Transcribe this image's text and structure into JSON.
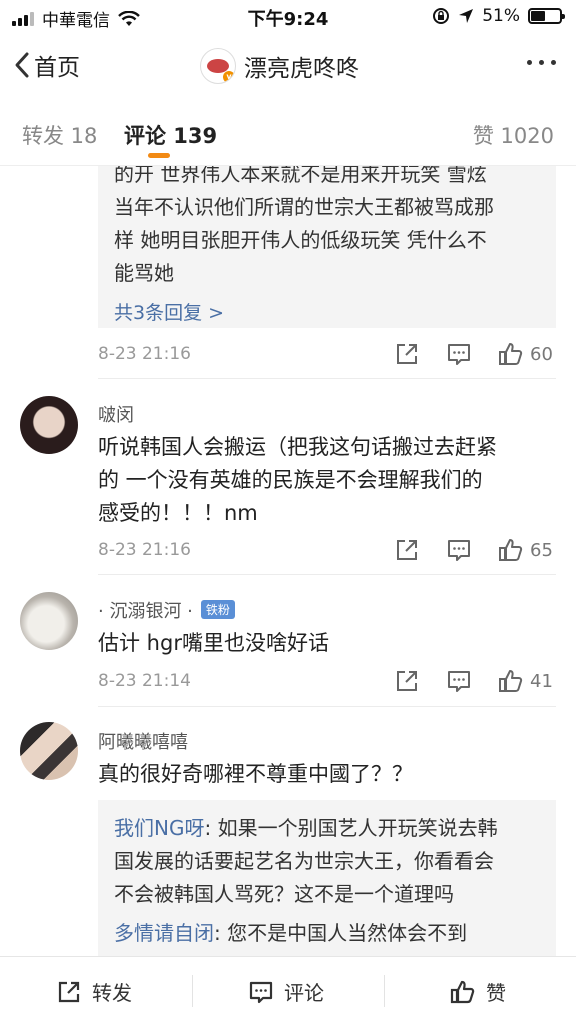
{
  "status_bar": {
    "carrier": "中華電信",
    "time": "下午9:24",
    "battery_percent": "51%",
    "battery_level": 0.51,
    "icons": [
      "signal-icon",
      "wifi-icon",
      "lock-rotation-icon",
      "location-icon",
      "battery-icon"
    ]
  },
  "nav": {
    "back_label": "首页",
    "title": "漂亮虎咚咚",
    "verified_badge": "v"
  },
  "tabs": {
    "repost": "转发 18",
    "comments": "评论 139",
    "likes": "赞 1020"
  },
  "partial_comment": {
    "reply_lines": [
      "的开 世界伟人本来就不是用来开玩笑 雪炫",
      "当年不认识他们所谓的世宗大王都被骂成那",
      "样 她明目张胆开伟人的低级玩笑 凭什么不",
      "能骂她"
    ],
    "more_replies": "共3条回复 >",
    "time": "8-23 21:16",
    "likes": "60"
  },
  "comments": [
    {
      "name": "啵闵",
      "text_lines": [
        "听说韩国人会搬运（把我这句话搬过去赶紧",
        "的  一个没有英雄的民族是不会理解我们的",
        "感受的！！！nm"
      ],
      "time": "8-23 21:16",
      "likes": "65"
    },
    {
      "name": "· 沉溺银河 ·",
      "badge": "铁粉",
      "text_lines": [
        "估计 hgr嘴里也没啥好话"
      ],
      "time": "8-23 21:14",
      "likes": "41"
    },
    {
      "name": "阿曦曦嘻嘻",
      "text_lines": [
        "真的很好奇哪裡不尊重中國了？？"
      ],
      "replies": [
        {
          "author": "我们NG呀",
          "lines": [
            "如果一个别国艺人开玩笑说去韩",
            "国发展的话要起艺名为世宗大王，你看看会",
            "不会被韩国人骂死？这不是一个道理吗"
          ]
        },
        {
          "author": "多情请自闭",
          "lines": [
            "您不是中国人当然体会不到"
          ]
        }
      ]
    }
  ],
  "bottom_bar": {
    "repost": "转发",
    "comment": "评论",
    "like": "赞"
  },
  "colors": {
    "accent": "#f28a14",
    "link": "#4a6fa5",
    "fan_badge": "#5a8fd6"
  }
}
